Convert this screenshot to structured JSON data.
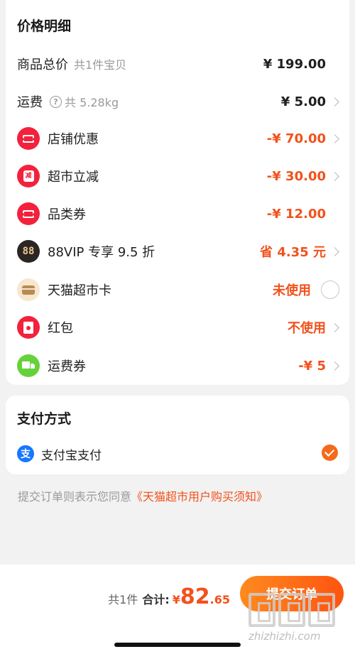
{
  "price_detail": {
    "title": "价格明细",
    "rows": [
      {
        "label": "商品总价",
        "sub": "共1件宝贝",
        "value": "¥ 199.00",
        "style": "plain",
        "chevron": false
      },
      {
        "label": "运费",
        "weight": "共 5.28kg",
        "value": "¥ 5.00",
        "style": "plain",
        "chevron": true,
        "icon": "question-icon"
      },
      {
        "label": "店铺优惠",
        "value": "-¥ 70.00",
        "style": "orange",
        "chevron": true,
        "icon": "shop-coupon-icon"
      },
      {
        "label": "超市立减",
        "value": "-¥ 30.00",
        "style": "orange",
        "chevron": true,
        "icon": "supermarket-discount-icon",
        "icon_text": "减"
      },
      {
        "label": "品类券",
        "value": "-¥ 12.00",
        "style": "orange",
        "chevron": false,
        "icon": "category-coupon-icon"
      },
      {
        "label": "88VIP 专享 9.5 折",
        "value": "省 4.35 元",
        "style": "orange",
        "chevron": true,
        "icon": "88vip-icon",
        "icon_text": "88"
      },
      {
        "label": "天猫超市卡",
        "value": "未使用",
        "style": "orange",
        "chevron": false,
        "icon": "card-icon",
        "radio": "unchecked"
      },
      {
        "label": "红包",
        "value": "不使用",
        "style": "orange",
        "chevron": true,
        "icon": "red-envelope-icon"
      },
      {
        "label": "运费券",
        "value": "-¥ 5",
        "style": "orange",
        "chevron": true,
        "icon": "shipping-coupon-icon"
      }
    ]
  },
  "payment": {
    "title": "支付方式",
    "method_label": "支付宝支付",
    "method_icon_text": "支",
    "selected": true
  },
  "agreement": {
    "text": "提交订单则表示您同意",
    "link": "《天猫超市用户购买须知》"
  },
  "footer": {
    "count": "共1件",
    "total_label": "合计:",
    "currency": "¥",
    "amount_int": "82",
    "amount_dec": ".65",
    "submit_label": "提交订单"
  },
  "watermark": {
    "text": "zhizhizhi.com"
  },
  "colors": {
    "accent": "#f2511b",
    "button_gradient_start": "#ff8a1f",
    "button_gradient_end": "#ff5410",
    "coupon_red": "#f3213c",
    "alipay_blue": "#1677ff"
  }
}
